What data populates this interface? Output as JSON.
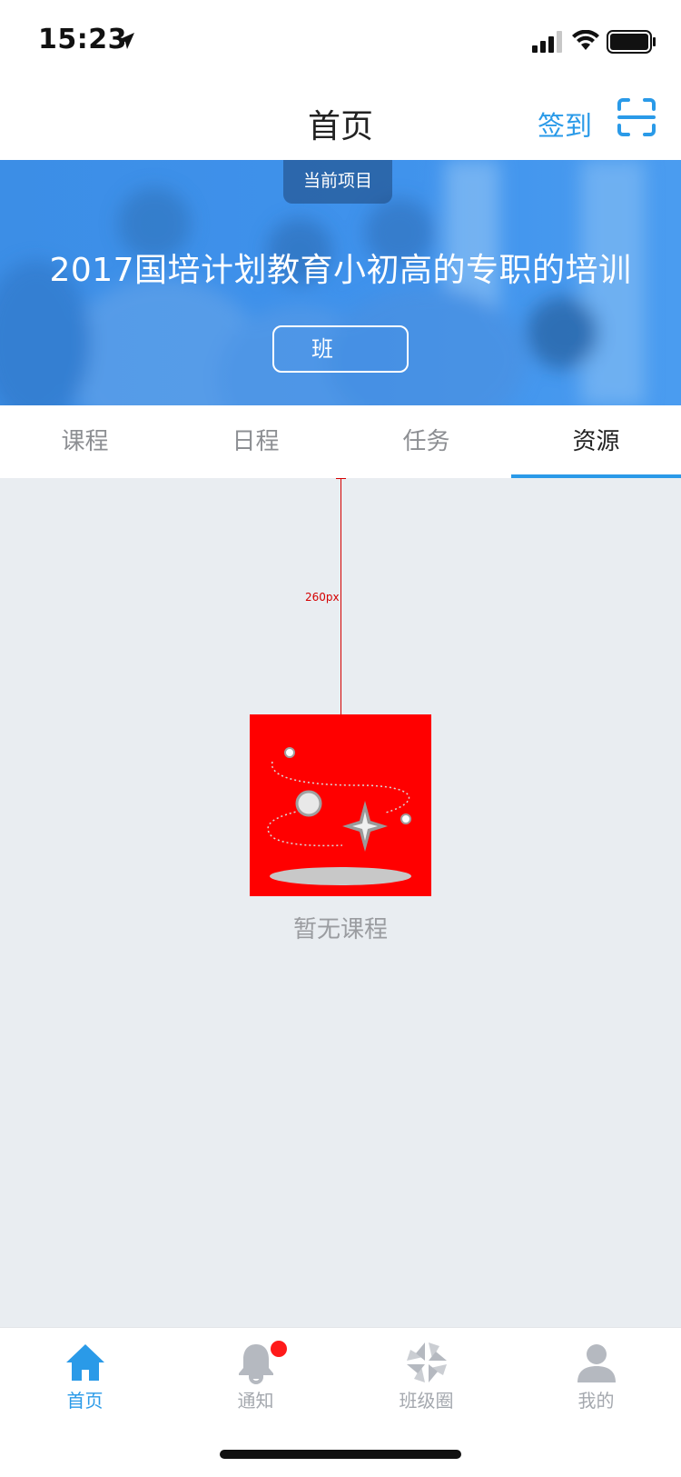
{
  "status_bar": {
    "time": "15:23",
    "icons": [
      "location-arrow-icon",
      "signal-icon",
      "wifi-icon",
      "battery-icon"
    ]
  },
  "nav": {
    "title": "首页",
    "checkin_label": "签到",
    "scan_icon": "scan-icon"
  },
  "banner": {
    "tag": "当前项目",
    "title": "2017国培计划教育小初高的专职的培训",
    "class_button": "班"
  },
  "tabs": [
    {
      "label": "课程",
      "active": false
    },
    {
      "label": "日程",
      "active": false
    },
    {
      "label": "任务",
      "active": false
    },
    {
      "label": "资源",
      "active": true
    }
  ],
  "content": {
    "spacing_label": "260px",
    "empty_text": "暂无课程",
    "empty_icon": "empty-space-illustration-icon"
  },
  "tabbar": {
    "items": [
      {
        "label": "首页",
        "icon": "home-icon",
        "active": true
      },
      {
        "label": "通知",
        "icon": "bell-icon",
        "active": false,
        "badge": true
      },
      {
        "label": "班级圈",
        "icon": "pinwheel-icon",
        "active": false
      },
      {
        "label": "我的",
        "icon": "user-icon",
        "active": false
      }
    ]
  },
  "colors": {
    "accent": "#2a9ae8",
    "banner_blue": "#3f92ec",
    "background": "#e9edf1",
    "badge_red": "#ff1a1a",
    "illustration_bg": "#ff0000"
  }
}
